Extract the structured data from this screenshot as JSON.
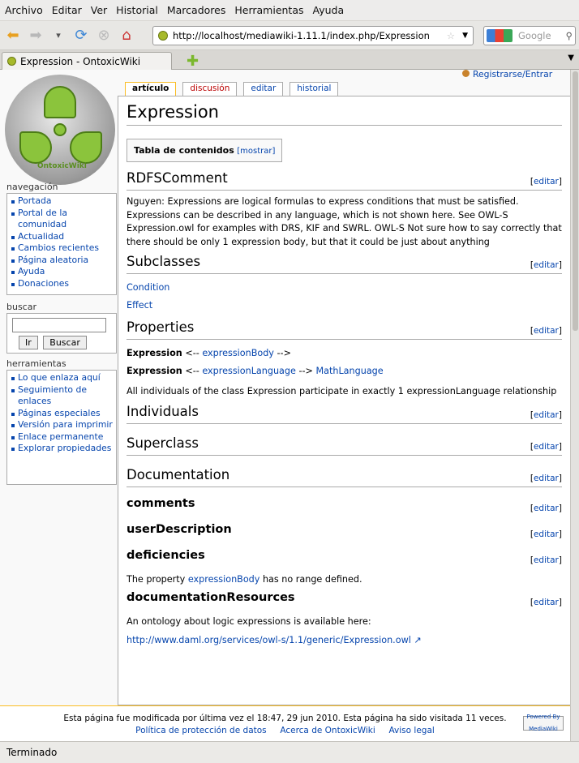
{
  "menu": [
    "Archivo",
    "Editar",
    "Ver",
    "Historial",
    "Marcadores",
    "Herramientas",
    "Ayuda"
  ],
  "browser": {
    "url": "http://localhost/mediawiki-1.11.1/index.php/Expression",
    "search_placeholder": "Google",
    "tab_title": "Expression - OntoxicWiki",
    "status": "Terminado"
  },
  "logo_text": "OntoxicWiki",
  "userlinks": "Registrarse/Entrar",
  "tabs": [
    "artículo",
    "discusión",
    "editar",
    "historial"
  ],
  "nav": {
    "title": "navegación",
    "items": [
      "Portada",
      "Portal de la comunidad",
      "Actualidad",
      "Cambios recientes",
      "Página aleatoria",
      "Ayuda",
      "Donaciones"
    ]
  },
  "search": {
    "title": "buscar",
    "go": "Ir",
    "search": "Buscar"
  },
  "tools": {
    "title": "herramientas",
    "items": [
      "Lo que enlaza aquí",
      "Seguimiento de enlaces",
      "Páginas especiales",
      "Versión para imprimir",
      "Enlace permanente",
      "Explorar propiedades"
    ]
  },
  "page": {
    "title": "Expression",
    "toc_label": "Tabla de contenidos",
    "toc_show": "[mostrar]",
    "edit": "editar",
    "rdfs_title": "RDFSComment",
    "rdfs_text": "Nguyen: Expressions are logical formulas to express conditions that must be satisfied. Expressions can be described in any language, which is not shown here. See OWL-S Expression.owl for examples with DRS, KIF and SWRL. OWL-S Not sure how to say correctly that there should be only 1 expression body, but that it could be just about anything",
    "subclasses_title": "Subclasses",
    "sub1": "Condition",
    "sub2": "Effect",
    "properties_title": "Properties",
    "prop1_a": "Expression",
    "prop1_b": " <-- ",
    "prop1_c": "expressionBody",
    "prop1_d": " -->",
    "prop2_a": "Expression",
    "prop2_b": " <-- ",
    "prop2_c": "expressionLanguage",
    "prop2_d": " --> ",
    "prop2_e": "MathLanguage",
    "prop_text": "All individuals of the class Expression participate in exactly 1 expressionLanguage relationship",
    "individuals_title": "Individuals",
    "superclass_title": "Superclass",
    "documentation_title": "Documentation",
    "comments_title": "comments",
    "userdesc_title": "userDescription",
    "deficiencies_title": "deficiencies",
    "def_a": "The property ",
    "def_b": "expressionBody",
    "def_c": " has no range defined.",
    "docres_title": "documentationResources",
    "docres_text": "An ontology about logic expressions is available here:",
    "docres_link": "http://www.daml.org/services/owl-s/1.1/generic/Expression.owl"
  },
  "footer": {
    "line1": "Esta página fue modificada por última vez el 18:47, 29 jun 2010.     Esta página ha sido visitada 11 veces.",
    "privacy": "Política de protección de datos",
    "about": "Acerca de OntoxicWiki",
    "disclaimer": "Aviso legal",
    "powered": "Powered By MediaWiki"
  }
}
